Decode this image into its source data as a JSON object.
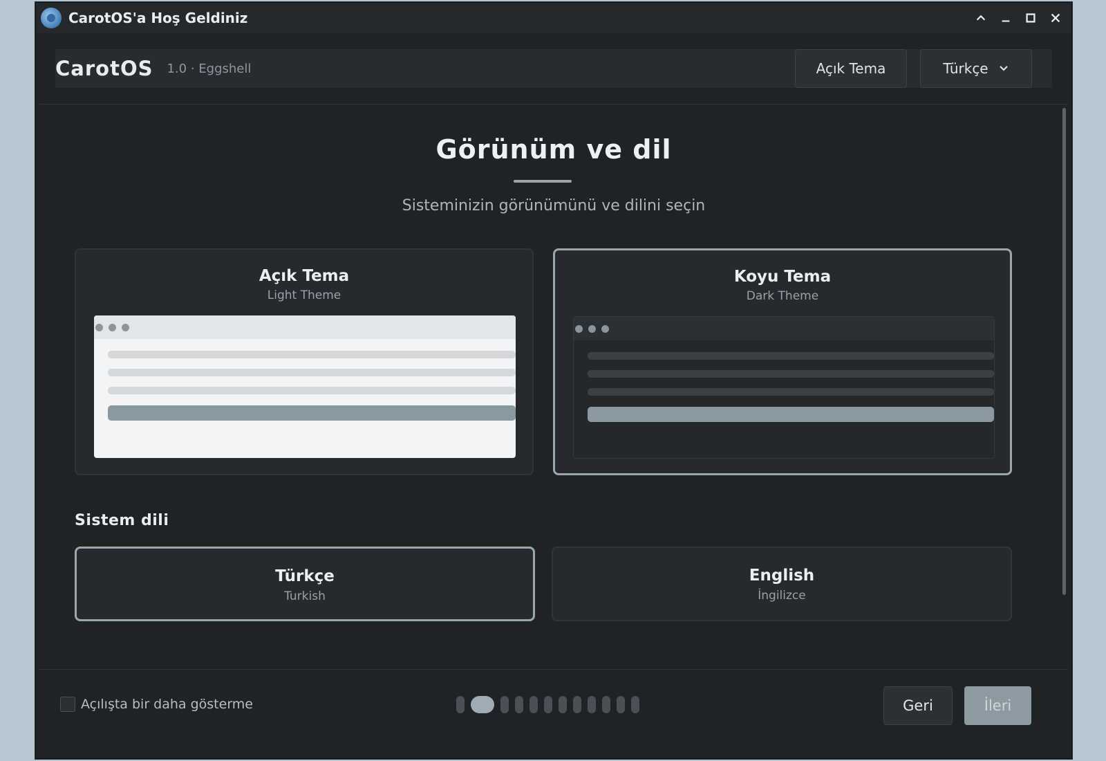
{
  "window": {
    "title": "CarotOS'a Hoş Geldiniz",
    "icons": [
      "carotos-logo-icon",
      "chevron-up-icon",
      "minimize-icon",
      "maximize-icon",
      "close-icon"
    ]
  },
  "header": {
    "brand": "CarotOS",
    "version": "1.0 · Eggshell",
    "theme_toggle_label": "Açık Tema",
    "language_select": "Türkçe"
  },
  "page": {
    "title": "Görünüm ve dil",
    "subtitle": "Sisteminizin görünümünü ve dilini seçin"
  },
  "themes": [
    {
      "title": "Açık Tema",
      "subtitle": "Light Theme",
      "selected": false
    },
    {
      "title": "Koyu Tema",
      "subtitle": "Dark Theme",
      "selected": true
    }
  ],
  "language_section": {
    "label": "Sistem dili",
    "options": [
      {
        "name": "Türkçe",
        "subtitle": "Turkish",
        "selected": true
      },
      {
        "name": "English",
        "subtitle": "İngilizce",
        "selected": false
      }
    ]
  },
  "footer": {
    "checkbox_label": "Açılışta bir daha gösterme",
    "checkbox_checked": false,
    "steps_total": 12,
    "steps_current": 2,
    "back_label": "Geri",
    "next_label": "İleri"
  },
  "colors": {
    "background": "#1f2326",
    "card": "#262a2e",
    "accent": "#9aa7ae",
    "desktop": "#b7c7d1"
  }
}
